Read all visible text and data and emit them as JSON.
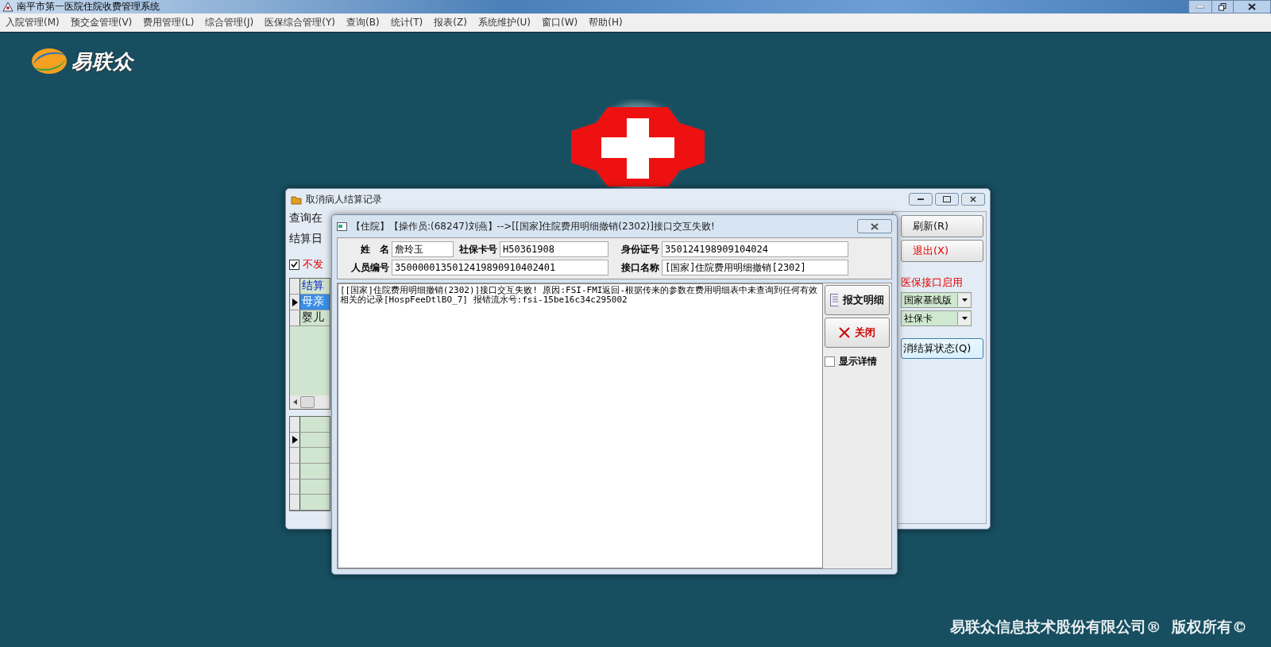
{
  "window": {
    "title": "南平市第一医院住院收费管理系统"
  },
  "menu": [
    "入院管理(M)",
    "预交金管理(V)",
    "费用管理(L)",
    "综合管理(J)",
    "医保综合管理(Y)",
    "查询(B)",
    "统计(T)",
    "报表(Z)",
    "系统维护(U)",
    "窗口(W)",
    "帮助(H)"
  ],
  "logo": {
    "text": "易联众"
  },
  "footer": "易联众信息技术股份有限公司®  版权所有©",
  "back_dialog": {
    "title": "取消病人结算记录",
    "query_label": "查询在",
    "date_label": "结算日",
    "checkbox": {
      "label": "不发",
      "checked": true
    },
    "grid_header": "结算",
    "grid_rows": [
      {
        "text": "母亲",
        "selected": true
      },
      {
        "text": "婴儿",
        "selected": false
      }
    ],
    "buttons": [
      {
        "label": "刷新(R)",
        "kind": "normal"
      },
      {
        "label": "退出(X)",
        "kind": "danger"
      }
    ],
    "interface_label": "医保接口启用",
    "selects": [
      "国家基线版",
      "社保卡"
    ],
    "cancel_button": "消结算状态(Q)"
  },
  "error_dialog": {
    "title": "【住院】【操作员:(68247)刘燕】-->[[国家]住院费用明细撤销(2302)]接口交互失败!",
    "fields": [
      {
        "label": "姓　名",
        "value": "詹玲玉"
      },
      {
        "label": "社保卡号",
        "value": "H50361908"
      },
      {
        "label": "身份证号",
        "value": "350124198909104024"
      },
      {
        "label": "人员编号",
        "value": "3500000135012419890910402401"
      },
      {
        "label": "接口名称",
        "value": "[国家]住院费用明细撤销[2302]"
      }
    ],
    "message": "[[国家]住院费用明细撤销(2302)]接口交互失败! 原因:FSI-FMI返回-根据传来的参数在费用明细表中未查询到任何有效相关的记录[HospFeeDtlBO_7] 报错流水号:fsi-15be16c34c295002",
    "buttons": [
      {
        "label": "报文明细",
        "kind": "detail"
      },
      {
        "label": "关闭",
        "kind": "close"
      }
    ],
    "checkbox": {
      "label": "显示详情",
      "checked": false
    }
  }
}
